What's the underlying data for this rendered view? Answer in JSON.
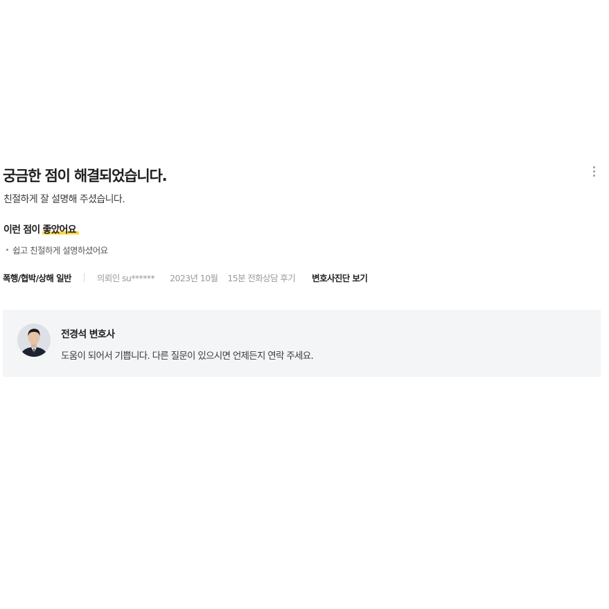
{
  "review": {
    "title": "궁금한 점이 해결되었습니다.",
    "body": "친절하게 잘 설명해 주셨습니다.",
    "likes_heading_prefix": "이런 점이 ",
    "likes_heading_highlight": "좋았어요",
    "likes": [
      "쉽고 친절하게 설명하셨어요"
    ],
    "more_icon": "more-vertical-icon",
    "highlight_color": "#ffd83a"
  },
  "meta": {
    "category": "폭행/협박/상해 일반",
    "client": "의뢰인 su******",
    "date": "2023년 10월",
    "consult": "15분 전화상담 후기",
    "diagnosis_link": "변호사진단 보기"
  },
  "reply": {
    "lawyer_name": "전경석 변호사",
    "message": "도움이 되어서 기쁩니다. 다른 질문이 있으시면 언제든지 연락 주세요.",
    "avatar_icon": "lawyer-avatar",
    "background_color": "#f4f5f7"
  }
}
